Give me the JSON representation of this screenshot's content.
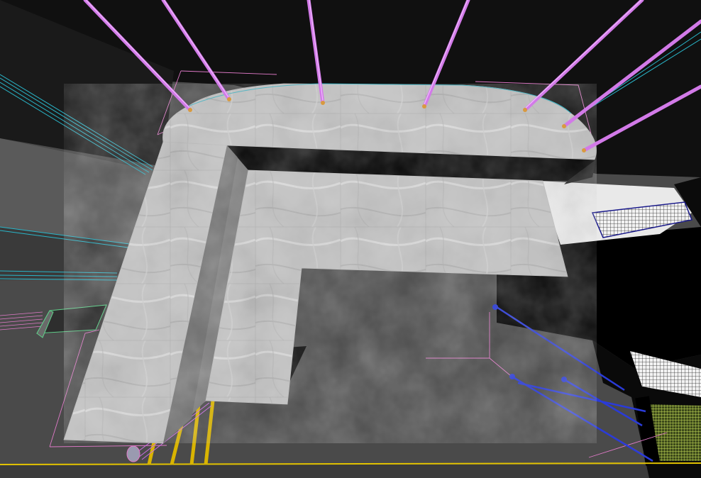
{
  "viewport": {
    "view": "perspective",
    "background_color": "#4a4a4a",
    "shading": "textured",
    "material_texture": "grey marble",
    "selection_color": "#e07ac8"
  },
  "scene": {
    "objects": [
      {
        "name": "countertop-slab",
        "material": "marble"
      },
      {
        "name": "countertop-front-fascia",
        "material": "grey"
      },
      {
        "name": "wall-cabinet-block",
        "material": "black"
      },
      {
        "name": "suspension-rods",
        "count": 7,
        "color": "#d27ae8"
      },
      {
        "name": "cyan-guide-lines",
        "color": "#29b5c8"
      },
      {
        "name": "mesh-grille-objects",
        "count": 3
      },
      {
        "name": "yellow-ground-line",
        "color": "#e2c200"
      },
      {
        "name": "blue-light-handles",
        "color": "#2a3bd8"
      }
    ]
  }
}
